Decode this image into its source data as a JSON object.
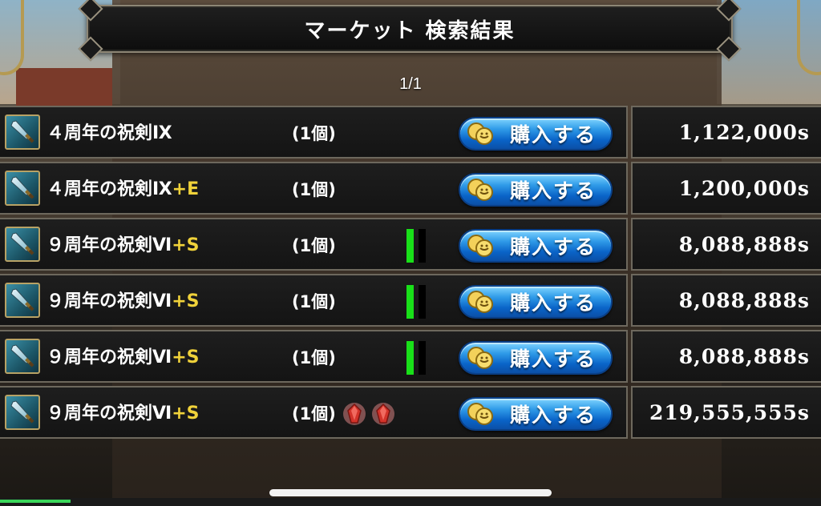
{
  "header": {
    "title": "マーケット 検索結果",
    "page_indicator": "1/1"
  },
  "colors": {
    "suffix": "#f0d23a",
    "gauge_fill": "#19e019",
    "button_blue": "#0a64c8"
  },
  "listings": [
    {
      "name": "４周年の祝剣Ⅸ",
      "suffix": "",
      "quantity": "(1個)",
      "buy_label": "購入する",
      "price": "1,122,000s",
      "gauge": false,
      "gems": 0
    },
    {
      "name": "４周年の祝剣Ⅸ",
      "suffix": "+E",
      "quantity": "(1個)",
      "buy_label": "購入する",
      "price": "1,200,000s",
      "gauge": false,
      "gems": 0
    },
    {
      "name": "９周年の祝剣Ⅵ",
      "suffix": "+S",
      "quantity": "(1個)",
      "buy_label": "購入する",
      "price": "8,088,888s",
      "gauge": true,
      "gems": 0
    },
    {
      "name": "９周年の祝剣Ⅵ",
      "suffix": "+S",
      "quantity": "(1個)",
      "buy_label": "購入する",
      "price": "8,088,888s",
      "gauge": true,
      "gems": 0
    },
    {
      "name": "９周年の祝剣Ⅵ",
      "suffix": "+S",
      "quantity": "(1個)",
      "buy_label": "購入する",
      "price": "8,088,888s",
      "gauge": true,
      "gems": 0
    },
    {
      "name": "９周年の祝剣Ⅵ",
      "suffix": "+S",
      "quantity": "(1個)",
      "buy_label": "購入する",
      "price": "219,555,555s",
      "gauge": false,
      "gems": 2
    }
  ],
  "icons": {
    "item": "sword-icon",
    "coin": "coin-icon",
    "gem": "red-gem-icon"
  }
}
